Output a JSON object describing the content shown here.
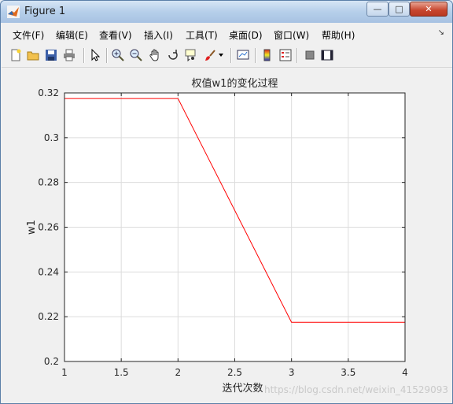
{
  "window": {
    "title": "Figure 1",
    "min_glyph": "—",
    "max_glyph": "□",
    "close_glyph": "✕"
  },
  "menu": {
    "items": [
      "文件(F)",
      "编辑(E)",
      "查看(V)",
      "插入(I)",
      "工具(T)",
      "桌面(D)",
      "窗口(W)",
      "帮助(H)"
    ],
    "overflow_glyph": "↘"
  },
  "toolbar": {
    "icons": [
      "new-figure-icon",
      "open-file-icon",
      "save-icon",
      "print-icon",
      "select-arrow-icon",
      "zoom-in-icon",
      "zoom-out-icon",
      "pan-hand-icon",
      "rotate-3d-icon",
      "data-cursor-icon",
      "brush-icon",
      "brush-dropdown-icon",
      "link-plot-icon",
      "colorbar-icon",
      "legend-icon",
      "hide-plot-tools-icon",
      "show-plot-tools-icon"
    ]
  },
  "chart_data": {
    "type": "line",
    "title": "权值w1的变化过程",
    "xlabel": "迭代次数",
    "ylabel": "w1",
    "xlim": [
      1,
      4
    ],
    "ylim": [
      0.2,
      0.32
    ],
    "xticks": [
      1,
      1.5,
      2,
      2.5,
      3,
      3.5,
      4
    ],
    "xtick_labels": [
      "1",
      "1.5",
      "2",
      "2.5",
      "3",
      "3.5",
      "4"
    ],
    "yticks": [
      0.2,
      0.22,
      0.24,
      0.26,
      0.28,
      0.3,
      0.32
    ],
    "ytick_labels": [
      "0.2",
      "0.22",
      "0.24",
      "0.26",
      "0.28",
      "0.3",
      "0.32"
    ],
    "grid": true,
    "series": [
      {
        "x": [
          1,
          2,
          3,
          4
        ],
        "y": [
          0.3175,
          0.3175,
          0.2175,
          0.2175
        ],
        "color": "#ff0000"
      }
    ]
  },
  "watermark": "https://blog.csdn.net/weixin_41529093"
}
